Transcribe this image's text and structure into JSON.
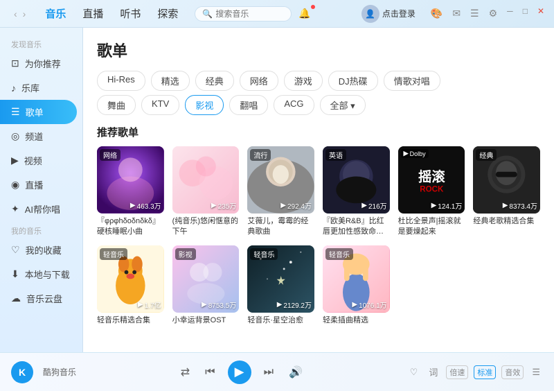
{
  "titleBar": {
    "navItems": [
      {
        "label": "音乐",
        "id": "music",
        "active": true
      },
      {
        "label": "直播",
        "id": "live",
        "active": false
      },
      {
        "label": "听书",
        "id": "audiobook",
        "active": false
      },
      {
        "label": "探索",
        "id": "explore",
        "active": false
      }
    ],
    "searchPlaceholder": "搜索音乐",
    "loginText": "点击登录",
    "windowControls": [
      "─",
      "□",
      "✕"
    ]
  },
  "sidebar": {
    "discoverLabel": "发现音乐",
    "items": [
      {
        "id": "recommend",
        "label": "为你推荐",
        "icon": "⊡"
      },
      {
        "id": "library",
        "label": "乐库",
        "icon": "♪"
      },
      {
        "id": "playlist",
        "label": "歌单",
        "icon": "☰",
        "active": true
      },
      {
        "id": "channel",
        "label": "频道",
        "icon": "◎"
      },
      {
        "id": "video",
        "label": "视频",
        "icon": "▶"
      },
      {
        "id": "live",
        "label": "直播",
        "icon": "◉"
      },
      {
        "id": "ai",
        "label": "AI帮你唱",
        "icon": "✦"
      }
    ],
    "myMusicLabel": "我的音乐",
    "myItems": [
      {
        "id": "favorites",
        "label": "我的收藏",
        "icon": "♡"
      },
      {
        "id": "local",
        "label": "本地与下载",
        "icon": "⬇"
      },
      {
        "id": "cloud",
        "label": "音乐云盘",
        "icon": "☁"
      }
    ]
  },
  "content": {
    "pageTitle": "歌单",
    "filterRows": [
      [
        {
          "label": "Hi-Res",
          "active": false
        },
        {
          "label": "精选",
          "active": false
        },
        {
          "label": "经典",
          "active": false
        },
        {
          "label": "网络",
          "active": false
        },
        {
          "label": "游戏",
          "active": false
        },
        {
          "label": "DJ热碟",
          "active": false
        },
        {
          "label": "情歌对唱",
          "active": false
        }
      ],
      [
        {
          "label": "舞曲",
          "active": false
        },
        {
          "label": "KTV",
          "active": false
        },
        {
          "label": "影视",
          "active": true
        },
        {
          "label": "翻唱",
          "active": false
        },
        {
          "label": "ACG",
          "active": false
        },
        {
          "label": "全部 ▾",
          "active": false,
          "more": true
        }
      ]
    ],
    "sectionTitle": "推荐歌单",
    "playlists": [
      {
        "id": 1,
        "badge": "网络",
        "count": "463.3万",
        "name": "『φρφhδoδnδkδ』硬核睡眠小曲",
        "theme": "purple"
      },
      {
        "id": 2,
        "badge": "",
        "count": "235万",
        "name": "(纯音乐)悠闲惬意的下午",
        "theme": "pink"
      },
      {
        "id": 3,
        "badge": "流行",
        "count": "292.4万",
        "name": "艾薇儿，霉霉的经典歌曲",
        "theme": "portrait_blonde"
      },
      {
        "id": 4,
        "badge": "英语",
        "count": "216万",
        "name": "『欧美R&B』比红唇更加性感致命的旋律",
        "theme": "dark_portrait"
      },
      {
        "id": 5,
        "badge": "Dolby",
        "count": "124.1万",
        "name": "杜比全景声|摇滚就是要燥起来",
        "theme": "rock"
      },
      {
        "id": 6,
        "badge": "经典",
        "count": "8373.4万",
        "name": "经典老歌精选合集",
        "theme": "classic_dark"
      },
      {
        "id": 7,
        "badge": "轻音乐",
        "count": "1.7亿",
        "name": "轻音乐精选合集",
        "theme": "cartoon_yellow"
      },
      {
        "id": 8,
        "badge": "影视",
        "count": "8753.5万",
        "name": "小幸运背景OST",
        "theme": "romance"
      },
      {
        "id": 9,
        "badge": "轻音乐",
        "count": "2129.2万",
        "name": "轻音乐·星空治愈",
        "theme": "stars"
      },
      {
        "id": 10,
        "badge": "轻音乐",
        "count": "1076.1万",
        "name": "轻柔插曲精选",
        "theme": "anime_girl"
      }
    ]
  },
  "player": {
    "logo": "K",
    "appName": "酷狗音乐",
    "controls": {
      "shuffle": "⇄",
      "prev": "⏮",
      "play": "▶",
      "next": "⏭",
      "volume": "♪"
    },
    "rightControls": {
      "like": "♡",
      "lyrics": "词",
      "speed": "倍速",
      "quality": "标准",
      "effect": "音效",
      "playlist": "☰"
    }
  }
}
